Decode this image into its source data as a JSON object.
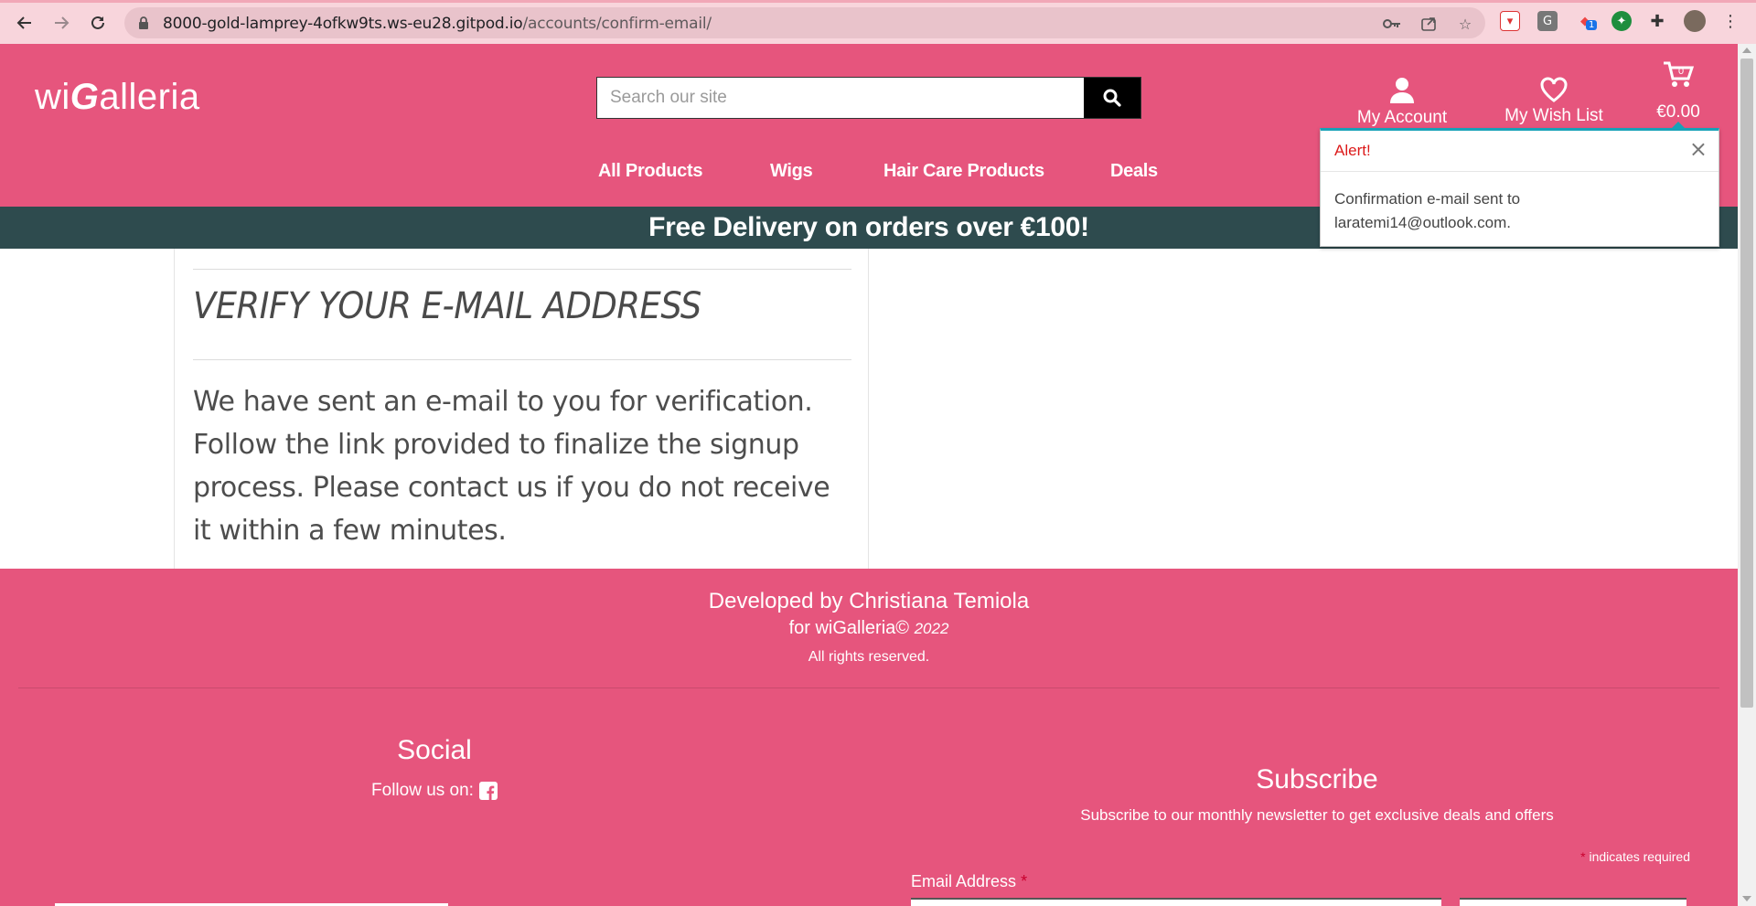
{
  "browser": {
    "url_host": "8000-gold-lamprey-4ofkw9ts.ws-eu28.gitpod.io",
    "url_path": "/accounts/confirm-email/",
    "extension_badge": "1"
  },
  "header": {
    "logo_prefix": "wi",
    "logo_g": "G",
    "logo_suffix": "alleria",
    "search_placeholder": "Search our site",
    "account_label": "My Account",
    "wishlist_label": "My Wish List",
    "cart_total": "€0.00",
    "cart_count": "0",
    "nav": [
      "All Products",
      "Wigs",
      "Hair Care Products",
      "Deals"
    ]
  },
  "banner": {
    "text": "Free Delivery on orders over €100!"
  },
  "main": {
    "title": "VERIFY YOUR E-MAIL ADDRESS",
    "body": "We have sent an e-mail to you for verification. Follow the link provided to finalize the signup process. Please contact us if you do not receive it within a few minutes."
  },
  "alert": {
    "title": "Alert!",
    "close": "×",
    "message": "Confirmation e-mail sent to laratemi14@outlook.com."
  },
  "footer": {
    "developer": "Developed by Christiana Temiola",
    "for_text": "for wiGalleria©",
    "year": "2022",
    "rights": "All rights reserved.",
    "social_title": "Social",
    "follow_text": "Follow us on:",
    "subscribe_title": "Subscribe",
    "subscribe_text": "Subscribe to our monthly newsletter to get exclusive deals and offers",
    "required_marker": "*",
    "required_text": "indicates required",
    "email_label": "Email Address"
  },
  "colors": {
    "brand_pink": "#e6557d",
    "banner_teal": "#2e4b4e",
    "alert_red": "#dc1a1a",
    "alert_accent": "#17a2b8"
  }
}
